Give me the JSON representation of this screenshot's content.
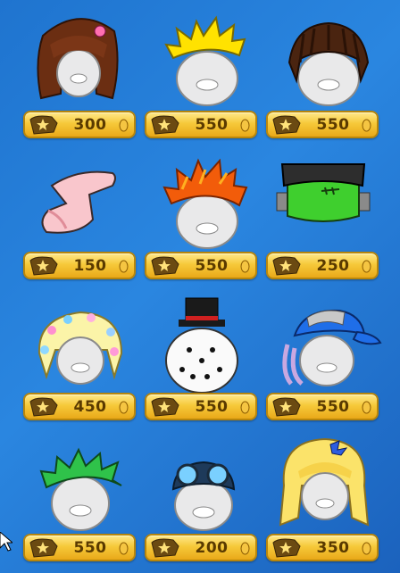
{
  "catalog": {
    "items": [
      {
        "name": "brown-long-hair-with-bow",
        "price": "300"
      },
      {
        "name": "yellow-spiky-hair",
        "price": "550"
      },
      {
        "name": "brown-dreadlocks",
        "price": "550"
      },
      {
        "name": "pink-sock-hat",
        "price": "150"
      },
      {
        "name": "red-spiky-hair",
        "price": "550"
      },
      {
        "name": "frankenstein-head",
        "price": "250"
      },
      {
        "name": "blonde-flower-hair",
        "price": "450"
      },
      {
        "name": "snowman-head-with-top-hat",
        "price": "550"
      },
      {
        "name": "blue-cap-purple-hair",
        "price": "550"
      },
      {
        "name": "green-spiky-hair",
        "price": "550"
      },
      {
        "name": "aviator-goggles-hat",
        "price": "200"
      },
      {
        "name": "long-blonde-hair-with-bow",
        "price": "350"
      }
    ]
  },
  "colors": {
    "background": "#2a86e0",
    "price_tag": "#f6c93a",
    "price_text": "#5a3a00"
  },
  "icons": {
    "member_badge": "member-star-badge-icon",
    "coin": "coin-icon"
  }
}
